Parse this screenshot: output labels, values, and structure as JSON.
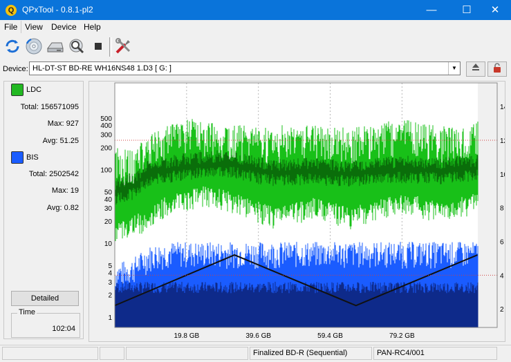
{
  "window": {
    "title": "QPxTool - 0.8.1-pl2",
    "minimize": "—",
    "maximize": "☐",
    "close": "✕"
  },
  "menu": {
    "items": [
      "File",
      "View",
      "Device",
      "Help"
    ]
  },
  "toolbar": {
    "icons": [
      "refresh-icon",
      "disc-info-icon",
      "drive-info-icon",
      "scan-icon",
      "stop-icon",
      "tools-icon"
    ]
  },
  "device": {
    "label": "Device:",
    "value": "HL-DT-ST BD-RE  WH16NS48  1.D3 [ G: ]",
    "eject_icon": "eject-icon",
    "lock_icon": "lock-icon"
  },
  "ldc": {
    "name": "LDC",
    "color": "#22b822",
    "total_label": "Total:",
    "total": "156571095",
    "max_label": "Max:",
    "max": "927",
    "avg_label": "Avg:",
    "avg": "51.25"
  },
  "bis": {
    "name": "BIS",
    "color": "#1a5cff",
    "total_label": "Total:",
    "total": "2502542",
    "max_label": "Max:",
    "max": "19",
    "avg_label": "Avg:",
    "avg": "0.82"
  },
  "detailed_button": "Detailed",
  "time": {
    "label": "Time",
    "value": "102:04"
  },
  "chart_data": {
    "type": "area",
    "x_unit": "GB",
    "xlim": [
      0,
      100.1
    ],
    "x_ticks": [
      {
        "value": 19.8,
        "label": "19.8 GB"
      },
      {
        "value": 39.6,
        "label": "39.6 GB"
      },
      {
        "value": 59.4,
        "label": "59.4 GB"
      },
      {
        "value": 79.2,
        "label": "79.2 GB"
      }
    ],
    "y_left_scale": "log",
    "y_left_ticks": [
      1,
      2,
      3,
      4,
      5,
      10,
      20,
      30,
      40,
      50,
      100,
      200,
      300,
      400,
      500
    ],
    "y_right_ticks": [
      2,
      4,
      6,
      8,
      10,
      12,
      14
    ],
    "grid": true,
    "series": [
      {
        "name": "LDC",
        "color": "#18c018",
        "x": [
          0,
          5,
          10,
          15,
          20,
          25,
          30,
          35,
          40,
          45,
          50,
          55,
          60,
          65,
          70,
          75,
          80,
          85,
          90,
          95,
          100
        ],
        "max": [
          200,
          180,
          300,
          400,
          500,
          450,
          420,
          400,
          380,
          400,
          420,
          400,
          380,
          400,
          420,
          450,
          500,
          420,
          400,
          420,
          450
        ],
        "min": [
          15,
          20,
          25,
          40,
          45,
          50,
          45,
          40,
          30,
          25,
          30,
          35,
          30,
          25,
          30,
          35,
          40,
          35,
          30,
          35,
          40
        ],
        "avg": [
          50,
          60,
          90,
          100,
          110,
          115,
          120,
          110,
          95,
          90,
          92,
          95,
          90,
          88,
          92,
          96,
          100,
          98,
          96,
          100,
          105
        ]
      },
      {
        "name": "BIS",
        "color": "#1a5cff",
        "x": [
          0,
          5,
          10,
          15,
          20,
          25,
          30,
          35,
          40,
          45,
          50,
          55,
          60,
          65,
          70,
          75,
          80,
          85,
          90,
          95,
          100
        ],
        "max": [
          5,
          6,
          9,
          10,
          10,
          10,
          10,
          10,
          10,
          10,
          10,
          10,
          10,
          10,
          10,
          10,
          10,
          10,
          10,
          10,
          10
        ],
        "avg": [
          3,
          3,
          3,
          3,
          3,
          3,
          3,
          3,
          3,
          3,
          3,
          3,
          3,
          3,
          3,
          3,
          3,
          3,
          3,
          3,
          3
        ]
      },
      {
        "name": "Speed",
        "color": "#000000",
        "axis": "right",
        "x": [
          0,
          33,
          66.5,
          100
        ],
        "values": [
          2.2,
          5.2,
          2.2,
          5.2
        ]
      }
    ]
  },
  "status": {
    "panes": [
      "",
      "",
      "",
      "Finalized BD-R (Sequential)",
      "PAN-RC4/001"
    ]
  }
}
